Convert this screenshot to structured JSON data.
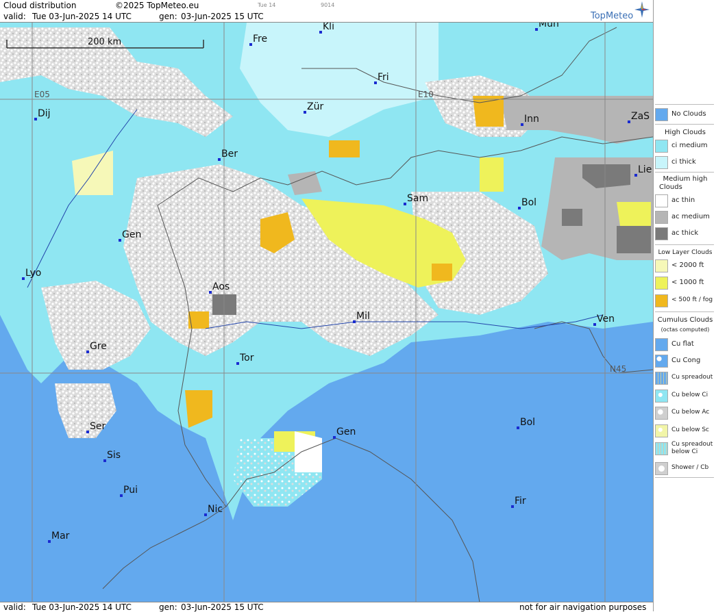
{
  "header": {
    "title": "Cloud distribution",
    "copyright": "©2025 TopMeteo.eu",
    "step": "Tue 14",
    "code": "9014",
    "valid_label": "valid:",
    "valid_value": "Tue  03-Jun-2025  14 UTC",
    "gen_label": "gen:",
    "gen_value": "03-Jun-2025 15 UTC",
    "logo": "TopMeteo"
  },
  "footer": {
    "valid_label": "valid:",
    "valid_value": "Tue  03-Jun-2025  14 UTC",
    "gen_label": "gen:",
    "gen_value": "03-Jun-2025 15 UTC",
    "disclaimer": "not for air navigation purposes"
  },
  "map": {
    "scale_label": "200 km",
    "grid_labels": {
      "e05": "E05",
      "e10": "E10",
      "n45": "N45"
    },
    "cities": [
      {
        "name": "Kli"
      },
      {
        "name": "Mun"
      },
      {
        "name": "Fre"
      },
      {
        "name": "Fri"
      },
      {
        "name": "Dij"
      },
      {
        "name": "Zür"
      },
      {
        "name": "Inn"
      },
      {
        "name": "ZaS"
      },
      {
        "name": "Ber"
      },
      {
        "name": "Lie"
      },
      {
        "name": "Sam"
      },
      {
        "name": "Bol"
      },
      {
        "name": "Gen"
      },
      {
        "name": "Lyo"
      },
      {
        "name": "Aos"
      },
      {
        "name": "Mil"
      },
      {
        "name": "Ven"
      },
      {
        "name": "Gre"
      },
      {
        "name": "Tor"
      },
      {
        "name": "Ser"
      },
      {
        "name": "Gen"
      },
      {
        "name": "Bol"
      },
      {
        "name": "Sis"
      },
      {
        "name": "Pui"
      },
      {
        "name": "Nic"
      },
      {
        "name": "Fir"
      },
      {
        "name": "Mar"
      }
    ]
  },
  "legend": {
    "no_clouds": "No Clouds",
    "high_title": "High Clouds",
    "ci_medium": "ci medium",
    "ci_thick": "ci thick",
    "medium_title_1": "Medium high",
    "medium_title_2": "Clouds",
    "ac_thin": "ac thin",
    "ac_medium": "ac medium",
    "ac_thick": "ac thick",
    "low_title": "Low Layer Clouds",
    "low_2000": "< 2000 ft",
    "low_1000": "< 1000 ft",
    "low_500": "< 500 ft / fog",
    "cu_title": "Cumulus Clouds",
    "cu_sub": "(octas computed)",
    "cu_flat": "Cu flat",
    "cu_cong": "Cu Cong",
    "cu_spread": "Cu spreadout",
    "cu_below_ci": "Cu below Ci",
    "cu_below_ac": "Cu below Ac",
    "cu_below_sc": "Cu below Sc",
    "cu_spread_ci_1": "Cu spreadout",
    "cu_spread_ci_2": "below Ci",
    "shower": "Shower / Cb"
  },
  "colors": {
    "no_clouds": "#63a9ee",
    "ci_medium": "#8fe6f2",
    "ci_thick": "#c8f5fb",
    "ac_thin": "#ffffff",
    "ac_medium": "#b5b5b5",
    "ac_thick": "#7a7a7a",
    "low_2000": "#f6f8b8",
    "low_1000": "#eef25a",
    "low_500": "#f0b81e",
    "border": "#555555",
    "city_marker": "#1a2bd0"
  }
}
